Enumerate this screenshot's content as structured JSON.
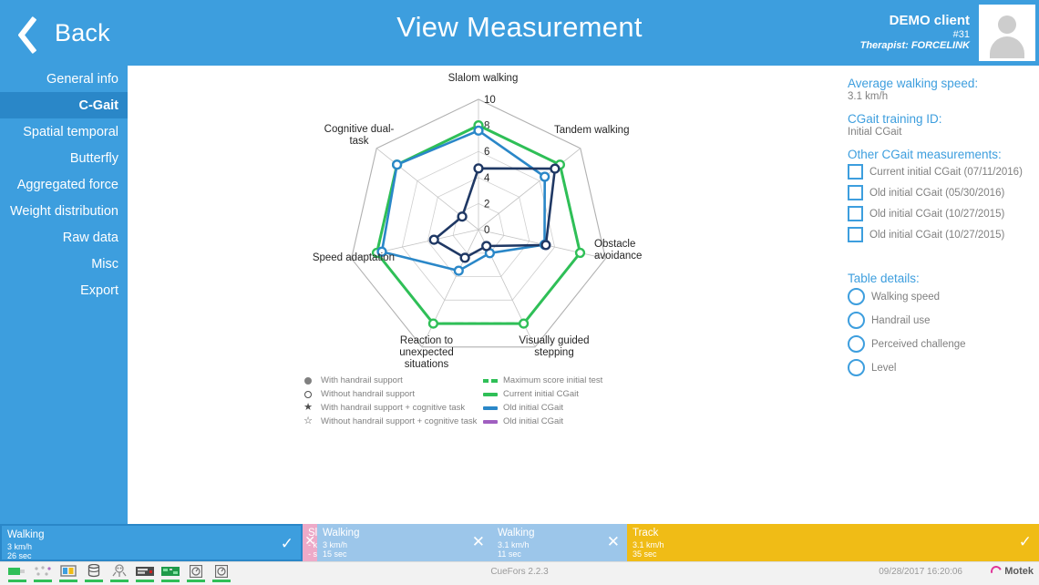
{
  "header": {
    "back_label": "Back",
    "title": "View Measurement",
    "client_name": "DEMO client",
    "client_id": "#31",
    "therapist": "Therapist: FORCELINK",
    "bg_color": "#3d9ede"
  },
  "sidebar": {
    "items": [
      {
        "label": "General info",
        "active": false
      },
      {
        "label": "C-Gait",
        "active": true
      },
      {
        "label": "Spatial temporal",
        "active": false
      },
      {
        "label": "Butterfly",
        "active": false
      },
      {
        "label": "Aggregated force",
        "active": false
      },
      {
        "label": "Weight distribution",
        "active": false
      },
      {
        "label": "Raw data",
        "active": false
      },
      {
        "label": "Misc",
        "active": false
      },
      {
        "label": "Export",
        "active": false
      }
    ]
  },
  "right_panel": {
    "avg_speed_label": "Average walking speed:",
    "avg_speed_value": "3.1 km/h",
    "training_id_label": "CGait training ID:",
    "training_id_value": "Initial CGait",
    "other_label": "Other CGait measurements:",
    "other_items": [
      {
        "label": "Current initial CGait (07/11/2016)",
        "checked": true
      },
      {
        "label": "Old initial CGait (05/30/2016)",
        "checked": true
      },
      {
        "label": "Old initial CGait (10/27/2015)",
        "checked": true
      },
      {
        "label": "Old initial CGait (10/27/2015)",
        "checked": true
      }
    ],
    "table_details_label": "Table details:",
    "table_details": [
      {
        "label": "Walking speed",
        "selected": true
      },
      {
        "label": "Handrail use",
        "selected": false
      },
      {
        "label": "Perceived challenge",
        "selected": false
      },
      {
        "label": "Level",
        "selected": false
      }
    ]
  },
  "chart_data": {
    "type": "radar",
    "title": "",
    "categories": [
      "Slalom walking",
      "Tandem walking",
      "Obstacle\navoidance",
      "Visually guided\nstepping",
      "Reaction to\nunexpected\nsituations",
      "Speed adaptation",
      "Cognitive dual-\ntask"
    ],
    "rlim": [
      0,
      10
    ],
    "rticks": [
      0,
      2,
      4,
      6,
      8,
      10
    ],
    "grid": true,
    "series": [
      {
        "name": "Maximum score initial test",
        "color": "#2fbf57",
        "style": "dashed",
        "values": [
          8,
          8,
          8,
          8,
          8,
          8,
          8
        ]
      },
      {
        "name": "Current initial CGait",
        "color": "#2fbf57",
        "style": "solid",
        "values": [
          8,
          8,
          8,
          8,
          8,
          8,
          8
        ]
      },
      {
        "name": "Old initial CGait",
        "color": "#2a87c8",
        "style": "solid",
        "values": [
          7.6,
          6.5,
          5.2,
          2.0,
          3.5,
          7.6,
          8
        ]
      },
      {
        "name": "Old initial CGait",
        "color": "#1f3864",
        "style": "solid",
        "values": [
          4.7,
          7.5,
          5.3,
          1.4,
          2.4,
          3.5,
          1.6
        ]
      }
    ],
    "legend_position": "bottom",
    "marker_legend": [
      {
        "label": "With handrail support",
        "marker": "filled-circle"
      },
      {
        "label": "Without handrail support",
        "marker": "open-circle"
      },
      {
        "label": "With handrail support + cognitive task",
        "marker": "filled-star"
      },
      {
        "label": "Without handrail support + cognitive task",
        "marker": "open-star"
      }
    ]
  },
  "timeline": {
    "segments": [
      {
        "name": "Walking",
        "speed": "3 km/h",
        "duration": "26 sec",
        "state": "selected",
        "mark": "✓"
      },
      {
        "name": "Slalom",
        "speed": "- km/h",
        "duration": "- sec",
        "state": "pink",
        "mark": "✕"
      },
      {
        "name": "Walking",
        "speed": "3 km/h",
        "duration": "15 sec",
        "state": "normal",
        "mark": "✕"
      },
      {
        "name": "Walking",
        "speed": "3.1 km/h",
        "duration": "11 sec",
        "state": "normal",
        "mark": "✕"
      },
      {
        "name": "Track",
        "speed": "3.1 km/h",
        "duration": "35 sec",
        "state": "track",
        "mark": "✓"
      }
    ]
  },
  "statusbar": {
    "version": "CueFors 2.2.3",
    "timestamp": "09/28/2017 16:20:06",
    "logo_text": "Motek",
    "tray_icons": [
      "usb-drive-icon",
      "network-nodes-icon",
      "monitor-icon",
      "database-icon",
      "robot-icon",
      "keyboard-icon",
      "circuit-board-icon",
      "gauge-icon",
      "gauge2-icon"
    ]
  }
}
